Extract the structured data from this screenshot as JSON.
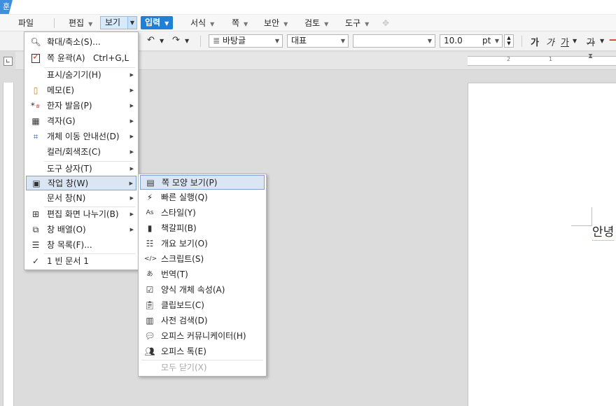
{
  "app": {
    "badge": "훈"
  },
  "menubar": {
    "file": "파일",
    "edit": "편집",
    "view": "보기",
    "input": "입력",
    "format": "서식",
    "page": "쪽",
    "security": "보안",
    "review": "검토",
    "tools": "도구"
  },
  "toolbar": {
    "font": "바탕글",
    "style": "대표",
    "face": "",
    "size": "10.0",
    "unit": "pt",
    "bold": "가",
    "italic": "가",
    "underline": "가",
    "strike": "가"
  },
  "ruler": {
    "marks": [
      "2",
      "1"
    ]
  },
  "document": {
    "text": "안녕"
  },
  "view_menu": {
    "items": [
      {
        "label": "확대/축소(S)...",
        "icon": "magnifier-icon"
      },
      {
        "label": "쪽 윤곽(A)",
        "shortcut": "Ctrl+G,L",
        "icon": "checked-checkbox-icon"
      },
      {
        "label": "표시/숨기기(H)",
        "submenu": true
      },
      {
        "label": "메모(E)",
        "submenu": true,
        "icon": "memo-icon"
      },
      {
        "label": "한자 발음(P)",
        "submenu": true,
        "icon": "hanja-pronunciation-icon"
      },
      {
        "label": "격자(G)",
        "submenu": true,
        "icon": "grid-icon"
      },
      {
        "label": "개체 이동 안내선(D)",
        "submenu": true,
        "icon": "object-guide-icon"
      },
      {
        "label": "컬러/회색조(C)",
        "submenu": true
      },
      {
        "label": "도구 상자(T)",
        "submenu": true
      },
      {
        "label": "작업 창(W)",
        "submenu": true,
        "icon": "task-pane-icon"
      },
      {
        "label": "문서 창(N)",
        "submenu": true
      },
      {
        "label": "편집 화면 나누기(B)",
        "submenu": true,
        "icon": "split-view-icon"
      },
      {
        "label": "창 배열(O)",
        "submenu": true,
        "icon": "arrange-windows-icon"
      },
      {
        "label": "창 목록(F)...",
        "icon": "window-list-icon"
      },
      {
        "label": "1 빈 문서 1",
        "icon": "checkmark-icon"
      }
    ]
  },
  "pane_menu": {
    "items": [
      {
        "label": "쪽 모양 보기(P)",
        "icon": "page-view-icon"
      },
      {
        "label": "빠른 실행(Q)",
        "icon": "quick-run-icon"
      },
      {
        "label": "스타일(Y)",
        "icon": "style-icon"
      },
      {
        "label": "책갈피(B)",
        "icon": "bookmark-icon"
      },
      {
        "label": "개요 보기(O)",
        "icon": "outline-icon"
      },
      {
        "label": "스크립트(S)",
        "icon": "script-icon"
      },
      {
        "label": "번역(T)",
        "icon": "translate-icon"
      },
      {
        "label": "양식 개체 속성(A)",
        "icon": "form-object-icon"
      },
      {
        "label": "클립보드(C)",
        "icon": "clipboard-icon"
      },
      {
        "label": "사전 검색(D)",
        "icon": "dictionary-icon"
      },
      {
        "label": "오피스 커뮤니케이터(H)",
        "icon": "communicator-icon"
      },
      {
        "label": "오피스 톡(E)",
        "icon": "office-talk-icon"
      },
      {
        "label": "모두 닫기(X)"
      }
    ]
  },
  "colors": {
    "accent": "#1f80d6",
    "highlight": "#dbe6f4",
    "check": "#d23a3a"
  }
}
